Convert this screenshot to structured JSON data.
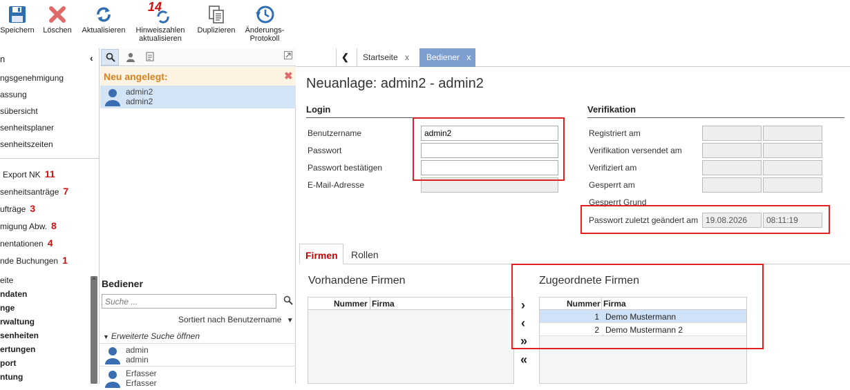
{
  "toolbar": {
    "save": "Speichern",
    "delete": "Löschen",
    "refresh": "Aktualisieren",
    "hints_line1": "Hinweiszahlen",
    "hints_line2": "aktualisieren",
    "hints_badge": "14",
    "duplicate": "Duplizieren",
    "history_line1": "Änderungs-",
    "history_line2": "Protokoll"
  },
  "nav": {
    "header": "n",
    "items": [
      "ngsgenehmigung",
      "assung",
      "sübersicht",
      "senheitsplaner",
      "senheitszeiten"
    ],
    "badged": [
      {
        "label": "Export NK",
        "count": "11"
      },
      {
        "label": "senheitsanträge",
        "count": "7"
      },
      {
        "label": "ufträge",
        "count": "3"
      },
      {
        "label": "migung Abw.",
        "count": "8"
      },
      {
        "label": "nentationen",
        "count": "4"
      },
      {
        "label": "nde Buchungen",
        "count": "1"
      }
    ],
    "sections": [
      "eite",
      "ndaten",
      "nge",
      "rwaltung",
      "senheiten",
      "ertungen",
      "port",
      "ntung"
    ]
  },
  "list_panel": {
    "new_header": "Neu angelegt:",
    "new_item": {
      "line1": "admin2",
      "line2": "admin2"
    },
    "section_title": "Bediener",
    "search_placeholder": "Suche ...",
    "sort_label": "Sortiert nach Benutzername",
    "advanced_search": "Erweiterte Suche öffnen",
    "users": [
      {
        "line1": "admin",
        "line2": "admin"
      },
      {
        "line1": "Erfasser",
        "line2": "Erfasser"
      }
    ]
  },
  "tabs": {
    "back": "❮",
    "items": [
      {
        "label": "Startseite",
        "close": "x"
      },
      {
        "label": "Bediener",
        "close": "x"
      }
    ]
  },
  "form": {
    "title": "Neuanlage: admin2 - admin2",
    "login_title": "Login",
    "username_label": "Benutzername",
    "username_value": "admin2",
    "password_label": "Passwort",
    "password_confirm_label": "Passwort bestätigen",
    "email_label": "E-Mail-Adresse",
    "verif_title": "Verifikation",
    "registered_label": "Registriert am",
    "verif_sent_label": "Verifikation versendet am",
    "verified_label": "Verifiziert am",
    "locked_label": "Gesperrt am",
    "locked_reason_label": "Gesperrt Grund",
    "pw_changed_label": "Passwort zuletzt geändert am",
    "pw_changed_date": "19.08.2026",
    "pw_changed_time": "08:11:19"
  },
  "subtabs": {
    "firmen": "Firmen",
    "rollen": "Rollen"
  },
  "firmen": {
    "available_title": "Vorhandene Firmen",
    "assigned_title": "Zugeordnete Firmen",
    "col_number": "Nummer",
    "col_firma": "Firma",
    "assigned_rows": [
      {
        "num": "1",
        "name": "Demo Mustermann"
      },
      {
        "num": "2",
        "name": "Demo Mustermann 2"
      }
    ],
    "btn_add": "›",
    "btn_remove": "‹",
    "btn_add_all": "»",
    "btn_remove_all": "«"
  }
}
